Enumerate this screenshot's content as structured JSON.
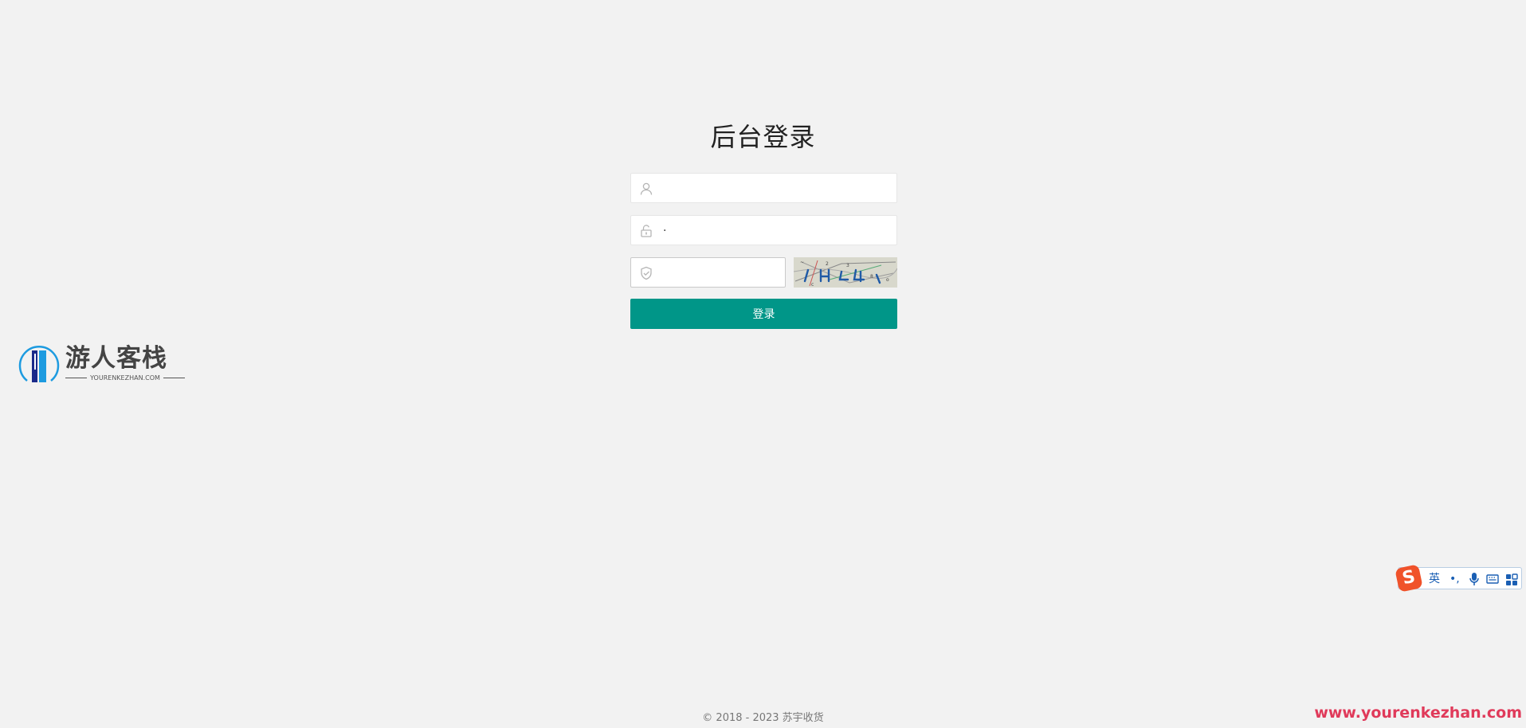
{
  "page": {
    "title": "后台登录"
  },
  "form": {
    "username_placeholder": "",
    "password_value": "·",
    "captcha_value": "",
    "submit_label": "登录"
  },
  "brand": {
    "name": "游人客栈",
    "domain": "YOURENKEZHAN.COM",
    "logo_colors": [
      "#1d9be0",
      "#1b2a8a"
    ]
  },
  "ime": {
    "mode_label": "英",
    "punct_label": "•,"
  },
  "footer": {
    "copyright": "© 2018 - 2023   苏宇收货"
  },
  "watermark": {
    "text": "www.yourenkezhan.com"
  },
  "colors": {
    "accent": "#009688",
    "background": "#f2f2f2",
    "watermark": "#e03a5a"
  },
  "icons": [
    "user-icon",
    "unlock-icon",
    "shield-check-icon",
    "microphone-icon",
    "keyboard-icon",
    "toolbox-icon"
  ]
}
